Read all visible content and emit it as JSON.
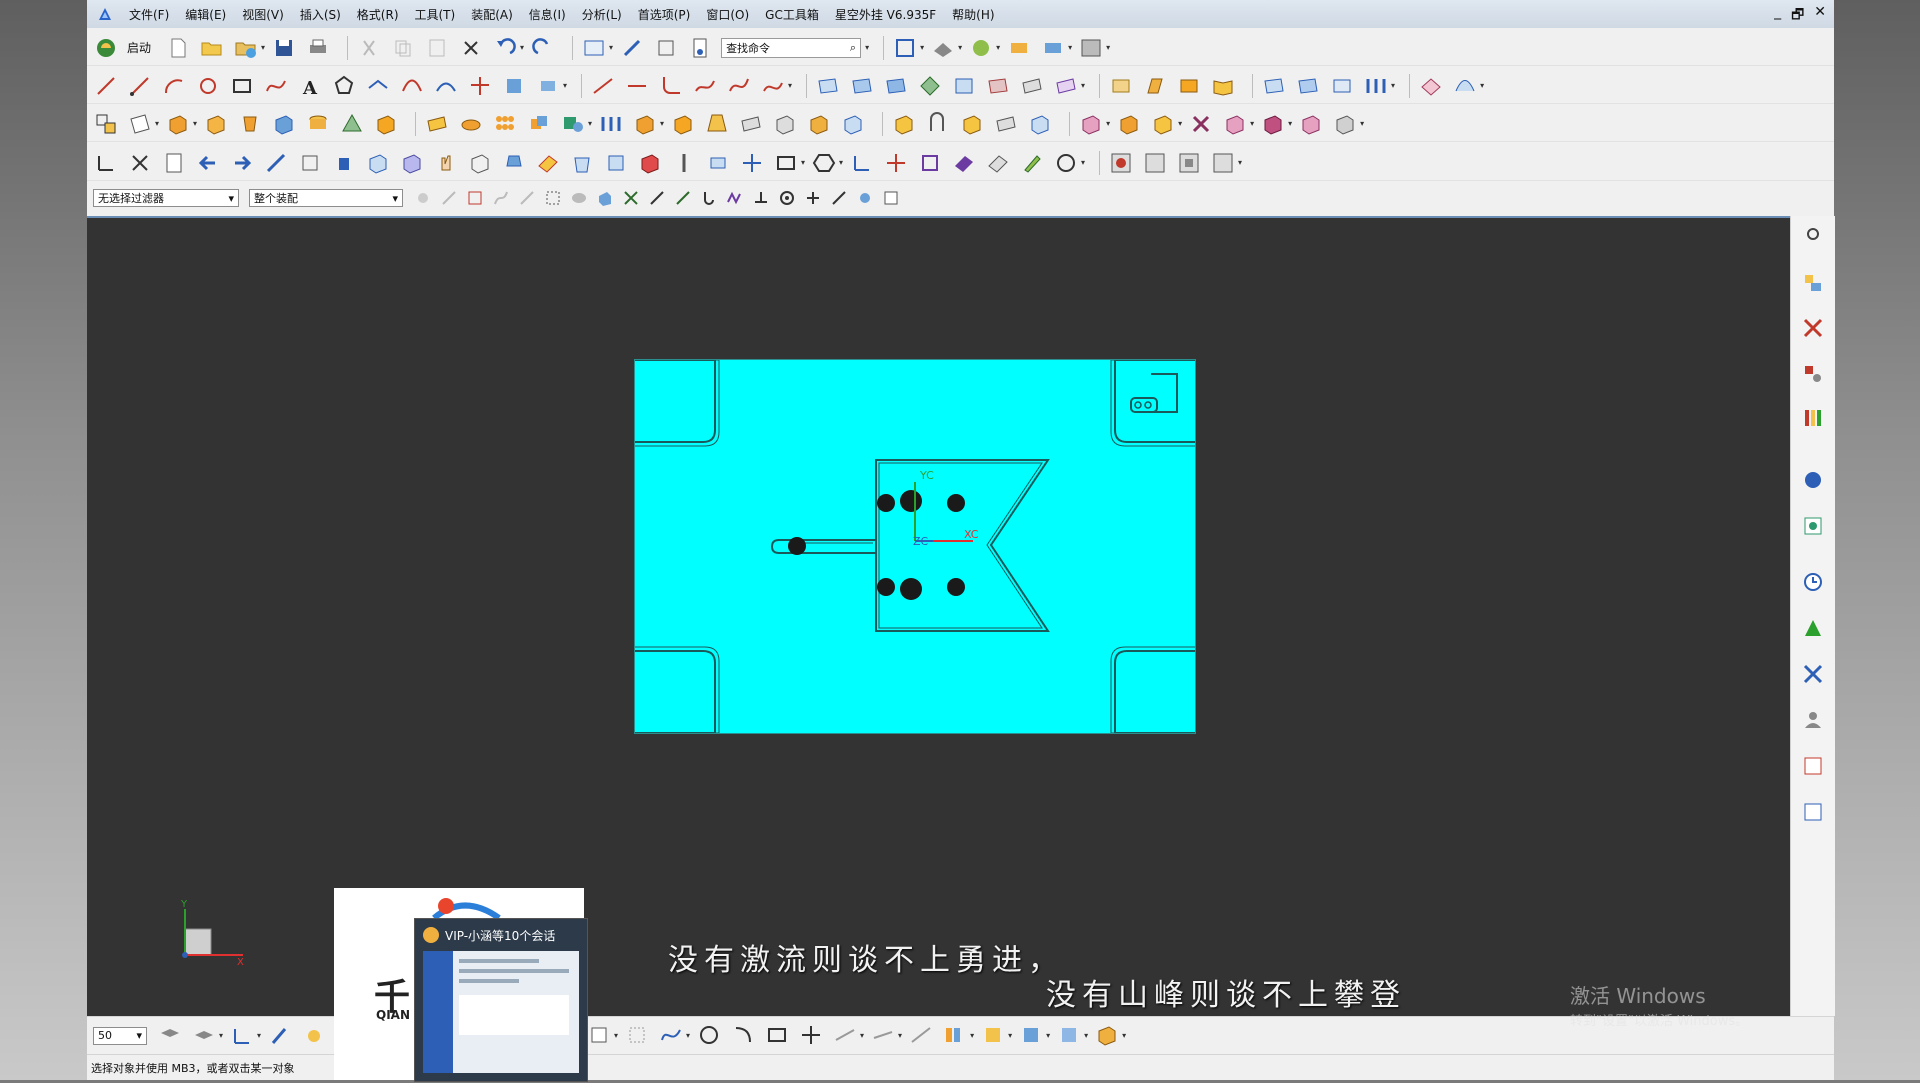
{
  "menubar": {
    "items": [
      "文件(F)",
      "编辑(E)",
      "视图(V)",
      "插入(S)",
      "格式(R)",
      "工具(T)",
      "装配(A)",
      "信息(I)",
      "分析(L)",
      "首选项(P)",
      "窗口(O)",
      "GC工具箱",
      "星空外挂 V6.935F",
      "帮助(H)"
    ],
    "window_controls": [
      "_",
      "🗗",
      "✕"
    ]
  },
  "toolbar": {
    "start_label": "启动",
    "search_placeholder": "查找命令"
  },
  "filters": {
    "selection_filter": "无选择过滤器",
    "assembly_scope": "整个装配"
  },
  "viewport": {
    "background": "#333333",
    "part_color": "#00ffff",
    "csys_labels": {
      "y": "YC",
      "x": "XC",
      "z": "ZC"
    },
    "triad_labels": {
      "y": "Y",
      "x": "X"
    }
  },
  "bottom_toolbar": {
    "zoom_value": "50"
  },
  "status": {
    "message": "选择对象并使用 MB3，或者双击某一对象"
  },
  "subtitles": {
    "line1": "没有激流则谈不上勇进，",
    "line2": "没有山峰则谈不上攀登"
  },
  "activation_watermark": {
    "title": "激活 Windows",
    "subtitle": "转到\"设置\"以激活 Windows。"
  },
  "popup": {
    "chat_title": "VIP-小涵等10个会话",
    "logo_text": "千",
    "logo_subtext": "QIAN"
  }
}
